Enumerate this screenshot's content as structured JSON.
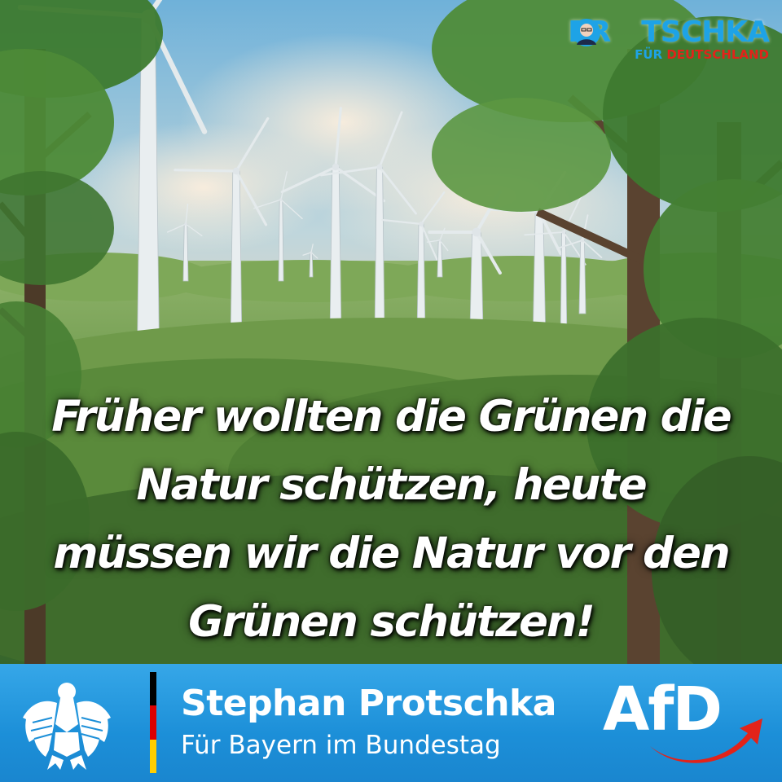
{
  "scene": {
    "description_icon": "wind-turbine-forest-illustration"
  },
  "brand": {
    "title_left": "PR",
    "title_right": "TSCHKA",
    "subtitle_a": "FÜR ",
    "subtitle_b": "DEUTSCHLAND",
    "icon": "portrait-face-icon"
  },
  "slogan": {
    "line1": "Früher wollten die Grünen die",
    "line2": "Natur schützen, heute",
    "line3": "müssen wir die Natur vor den",
    "line4": "Grünen schützen!"
  },
  "banner": {
    "name": "Stephan Protschka",
    "role": "Für Bayern im Bundestag",
    "party": "AfD",
    "eagle_icon": "federal-eagle-icon",
    "flag_icon": "german-flag-icon",
    "swoosh_icon": "red-arrow-swoosh-icon"
  },
  "colors": {
    "brand_blue": "#1ea3e6",
    "brand_red": "#e2231a",
    "banner_blue": "#1c8fd8",
    "flag_black": "#000000",
    "flag_red": "#dd0000",
    "flag_gold": "#ffce00"
  }
}
